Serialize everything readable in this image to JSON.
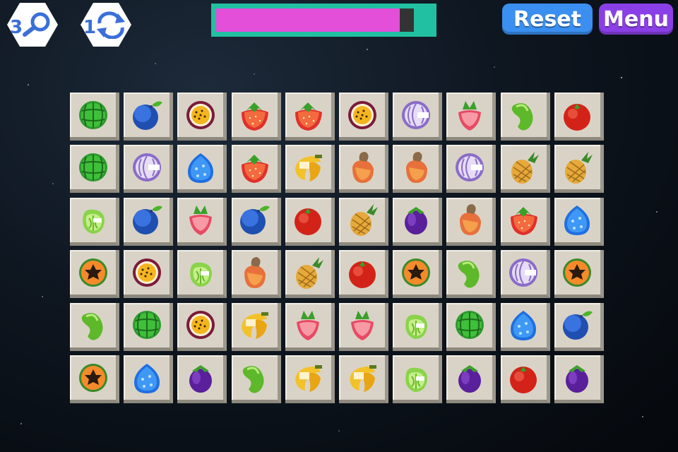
{
  "hud": {
    "hint_count": "3",
    "hint_icon": "magnifier-icon",
    "shuffle_count": "1",
    "shuffle_icon": "shuffle-icon",
    "timer_progress": 0.93,
    "timer_color": "#e34fd8",
    "reset_label": "Reset",
    "menu_label": "Menu"
  },
  "board": {
    "rows": 6,
    "cols": 10,
    "tiles": [
      [
        "watermelon",
        "blueberry",
        "passion-fruit",
        "strawberry",
        "strawberry",
        "passion-fruit",
        "red-cabbage",
        "radish",
        "green-bean",
        "tomato"
      ],
      [
        "watermelon",
        "red-cabbage",
        "blue-fruit",
        "strawberry",
        "banana",
        "cashew-apple",
        "cashew-apple",
        "red-cabbage",
        "pineapple",
        "pineapple"
      ],
      [
        "green-pepper",
        "blueberry",
        "radish",
        "blueberry",
        "tomato",
        "pineapple",
        "eggplant",
        "cashew-apple",
        "strawberry",
        "blue-fruit"
      ],
      [
        "papaya",
        "passion-fruit",
        "green-pepper",
        "cashew-apple",
        "pineapple",
        "tomato",
        "papaya",
        "green-bean",
        "red-cabbage",
        "papaya"
      ],
      [
        "green-bean",
        "watermelon",
        "passion-fruit",
        "banana",
        "radish",
        "radish",
        "green-pepper",
        "watermelon",
        "blue-fruit",
        "blueberry"
      ],
      [
        "papaya",
        "blue-fruit",
        "eggplant",
        "green-bean",
        "banana",
        "banana",
        "green-pepper",
        "eggplant",
        "tomato",
        "eggplant"
      ]
    ]
  }
}
